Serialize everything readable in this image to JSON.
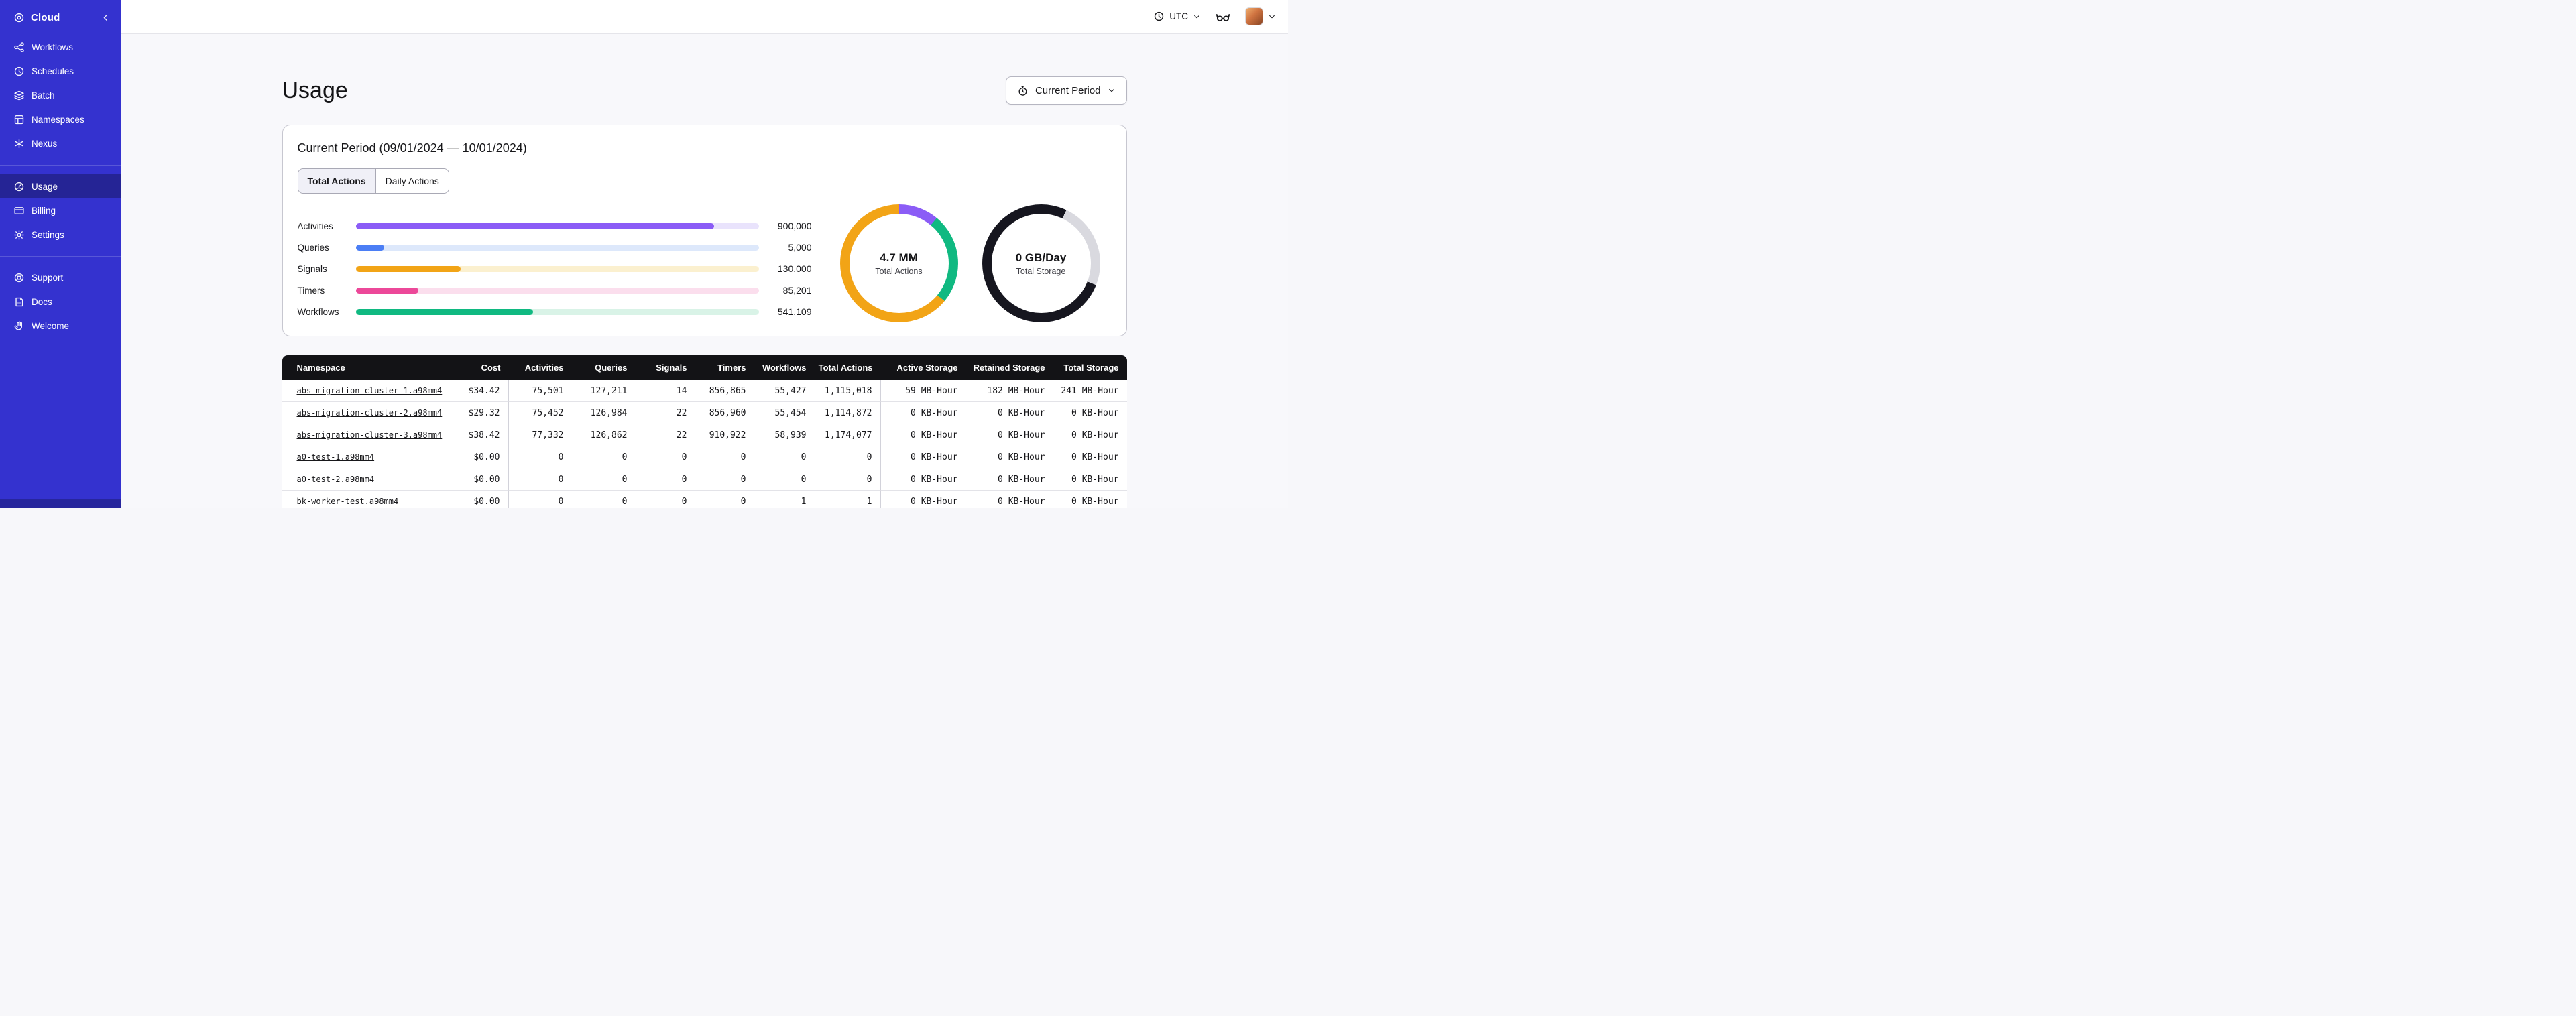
{
  "colors": {
    "sidebar_bg": "#3432cf",
    "sidebar_active": "rgba(0,0,0,0.28)",
    "table_header_bg": "#131316",
    "accent_purple": "#8b5cf6",
    "accent_blue": "#4b7ef5",
    "accent_orange": "#f2a416",
    "accent_pink": "#ec4899",
    "accent_green": "#10b981"
  },
  "sidebar": {
    "brand": "Cloud",
    "sections": [
      [
        {
          "label": "Workflows",
          "icon": "workflows-icon"
        },
        {
          "label": "Schedules",
          "icon": "schedules-icon"
        },
        {
          "label": "Batch",
          "icon": "batch-icon"
        },
        {
          "label": "Namespaces",
          "icon": "namespaces-icon"
        },
        {
          "label": "Nexus",
          "icon": "nexus-icon"
        }
      ],
      [
        {
          "label": "Usage",
          "icon": "usage-icon",
          "active": true
        },
        {
          "label": "Billing",
          "icon": "billing-icon"
        },
        {
          "label": "Settings",
          "icon": "settings-icon"
        }
      ],
      [
        {
          "label": "Support",
          "icon": "support-icon"
        },
        {
          "label": "Docs",
          "icon": "docs-icon"
        },
        {
          "label": "Welcome",
          "icon": "welcome-icon"
        }
      ]
    ]
  },
  "topbar": {
    "timezone": "UTC"
  },
  "page": {
    "title": "Usage",
    "period_button": "Current Period"
  },
  "usage_card": {
    "title": "Current Period (09/01/2024 — 10/01/2024)",
    "tabs": [
      {
        "label": "Total Actions",
        "active": true
      },
      {
        "label": "Daily Actions",
        "active": false
      }
    ]
  },
  "chart_data": [
    {
      "type": "bar",
      "orientation": "horizontal",
      "categories": [
        "Activities",
        "Queries",
        "Signals",
        "Timers",
        "Workflows"
      ],
      "values": [
        900000,
        5000,
        130000,
        85201,
        541109
      ],
      "value_labels": [
        "900,000",
        "5,000",
        "130,000",
        "85,201",
        "541,109"
      ],
      "bar_percents": [
        89,
        7,
        26,
        15.5,
        44
      ],
      "colors": [
        "#8b5cf6",
        "#4b7ef5",
        "#f2a416",
        "#ec4899",
        "#10b981"
      ],
      "track_colors": [
        "#e9e3fc",
        "#dde8fb",
        "#fbf0cf",
        "#fbdeed",
        "#d9f3e7"
      ],
      "title": "",
      "xlabel": "",
      "ylabel": "",
      "grid": false,
      "legend": "none"
    },
    {
      "type": "pie",
      "title": "Total Actions",
      "center_value": "4.7 MM",
      "segments": [
        {
          "name": "purple",
          "value": 11,
          "color": "#8b5cf6"
        },
        {
          "name": "green",
          "value": 25,
          "color": "#10b981"
        },
        {
          "name": "orange",
          "value": 64,
          "color": "#f2a416"
        }
      ]
    },
    {
      "type": "pie",
      "title": "Total Storage",
      "center_value": "0 GB/Day",
      "segments": [
        {
          "name": "dark",
          "value": 7,
          "color": "#16161f"
        },
        {
          "name": "light",
          "value": 24,
          "color": "#d9d9df"
        },
        {
          "name": "dark2",
          "value": 69,
          "color": "#16161f"
        }
      ]
    }
  ],
  "table": {
    "columns": [
      "Namespace",
      "Cost",
      "Activities",
      "Queries",
      "Signals",
      "Timers",
      "Workflows",
      "Total Actions",
      "Active Storage",
      "Retained Storage",
      "Total Storage"
    ],
    "rows": [
      [
        "abs-migration-cluster-1.a98mm4",
        "$34.42",
        "75,501",
        "127,211",
        "14",
        "856,865",
        "55,427",
        "1,115,018",
        "59 MB-Hour",
        "182 MB-Hour",
        "241 MB-Hour"
      ],
      [
        "abs-migration-cluster-2.a98mm4",
        "$29.32",
        "75,452",
        "126,984",
        "22",
        "856,960",
        "55,454",
        "1,114,872",
        "0 KB-Hour",
        "0 KB-Hour",
        "0 KB-Hour"
      ],
      [
        "abs-migration-cluster-3.a98mm4",
        "$38.42",
        "77,332",
        "126,862",
        "22",
        "910,922",
        "58,939",
        "1,174,077",
        "0 KB-Hour",
        "0 KB-Hour",
        "0 KB-Hour"
      ],
      [
        "a0-test-1.a98mm4",
        "$0.00",
        "0",
        "0",
        "0",
        "0",
        "0",
        "0",
        "0 KB-Hour",
        "0 KB-Hour",
        "0 KB-Hour"
      ],
      [
        "a0-test-2.a98mm4",
        "$0.00",
        "0",
        "0",
        "0",
        "0",
        "0",
        "0",
        "0 KB-Hour",
        "0 KB-Hour",
        "0 KB-Hour"
      ],
      [
        "bk-worker-test.a98mm4",
        "$0.00",
        "0",
        "0",
        "0",
        "0",
        "1",
        "1",
        "0 KB-Hour",
        "0 KB-Hour",
        "0 KB-Hour"
      ]
    ]
  }
}
